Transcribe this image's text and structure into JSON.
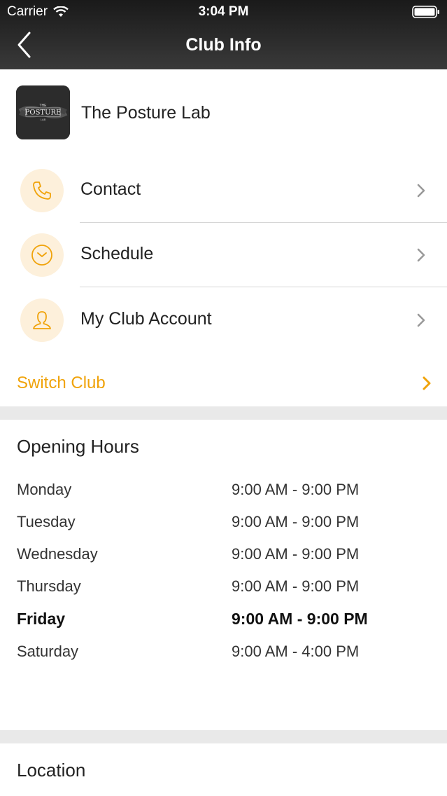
{
  "status_bar": {
    "carrier": "Carrier",
    "time": "3:04 PM"
  },
  "nav": {
    "title": "Club Info"
  },
  "club": {
    "name": "The Posture Lab",
    "logo_text_top": "THE",
    "logo_text_main": "POSTURE",
    "logo_text_bottom": "LAB"
  },
  "menu": [
    {
      "label": "Contact",
      "icon": "phone-icon"
    },
    {
      "label": "Schedule",
      "icon": "clock-icon"
    },
    {
      "label": "My Club Account",
      "icon": "user-icon"
    }
  ],
  "switch_club": {
    "label": "Switch Club"
  },
  "opening_hours": {
    "title": "Opening Hours",
    "rows": [
      {
        "day": "Monday",
        "time": "9:00 AM - 9:00 PM"
      },
      {
        "day": "Tuesday",
        "time": "9:00 AM - 9:00 PM"
      },
      {
        "day": "Wednesday",
        "time": "9:00 AM - 9:00 PM"
      },
      {
        "day": "Thursday",
        "time": "9:00 AM - 9:00 PM"
      },
      {
        "day": "Friday",
        "time": "9:00 AM - 9:00 PM"
      },
      {
        "day": "Saturday",
        "time": "9:00 AM - 4:00 PM"
      }
    ]
  },
  "location": {
    "title": "Location"
  },
  "colors": {
    "accent": "#f0a30a",
    "icon_bg": "#fdf0db",
    "nav_bg": "#1f1f1f"
  }
}
